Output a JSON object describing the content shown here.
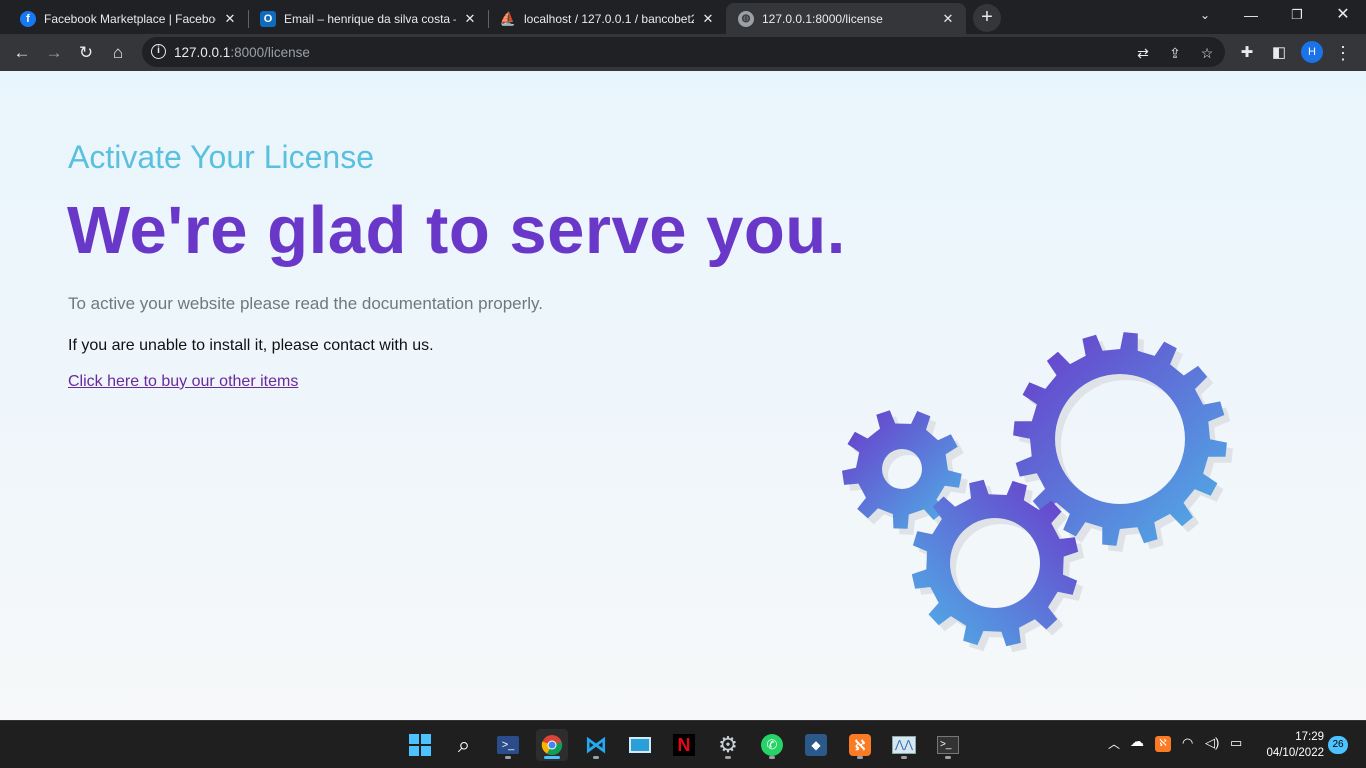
{
  "browser": {
    "tabs": [
      {
        "title": "Facebook Marketplace | Facebook",
        "favicon": "facebook-icon"
      },
      {
        "title": "Email – henrique da silva costa – Outlook",
        "favicon": "outlook-icon"
      },
      {
        "title": "localhost / 127.0.0.1 / bancobet2",
        "favicon": "phpmyadmin-icon"
      },
      {
        "title": "127.0.0.1:8000/license",
        "favicon": "globe-icon"
      }
    ],
    "active_tab": 3,
    "address": {
      "host": "127.0.0.1",
      "path": ":8000/license"
    },
    "avatar_initial": "H"
  },
  "page": {
    "subtitle": "Activate Your License",
    "headline": "We're glad to serve you.",
    "lead": "To active your website please read the documentation properly.",
    "contact_text": "If you are unable to install it, please contact with us.",
    "link_text": "Click here to buy our other items",
    "colors": {
      "subtitle": "#5bc0de",
      "headline": "#6a38c9",
      "gear_start": "#6a38c9",
      "gear_end": "#4fb3e8"
    }
  },
  "taskbar": {
    "apps": [
      "windows-start-icon",
      "search-icon",
      "powershell-icon",
      "chrome-icon",
      "vscode-icon",
      "remote-desktop-icon",
      "netflix-icon",
      "settings-icon",
      "whatsapp-icon",
      "mysql-workbench-icon",
      "xampp-icon",
      "resource-monitor-icon",
      "terminal-icon"
    ],
    "time": "17:29",
    "date": "04/10/2022",
    "notification_count": "26"
  }
}
